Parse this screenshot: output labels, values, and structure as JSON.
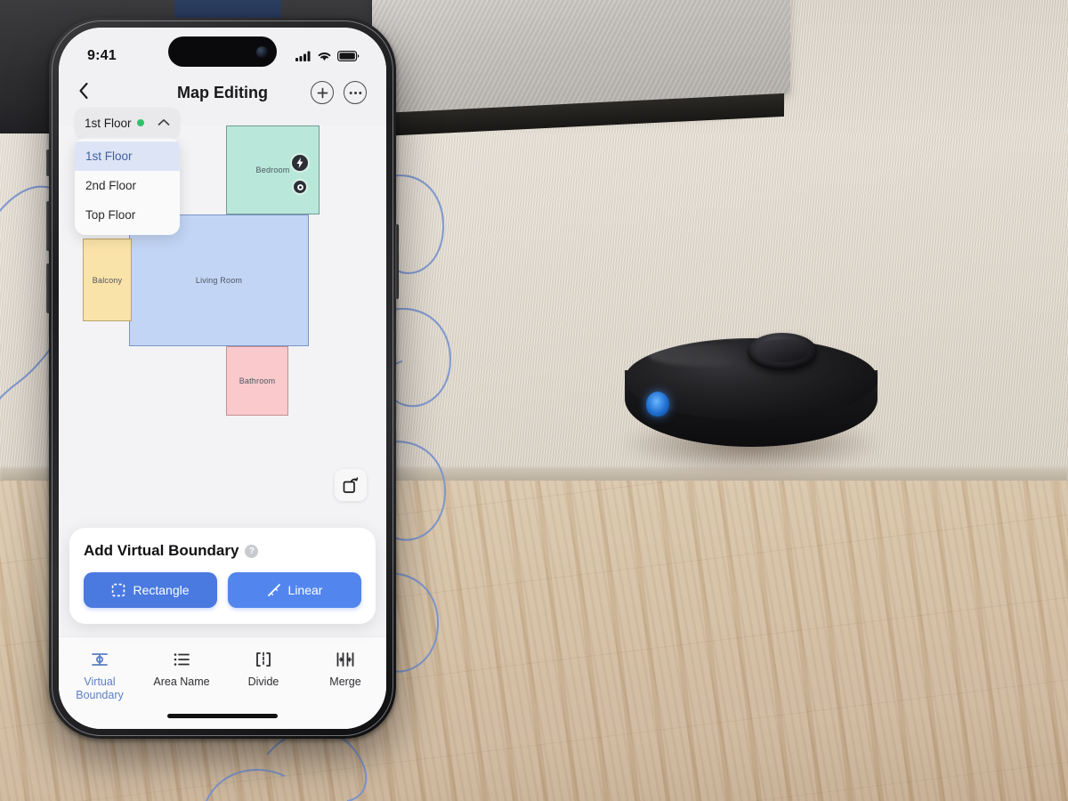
{
  "scene": {
    "description": "Robot vacuum on light wood floor next to beige area rug and grey sofa, with blue robot cleaning path lines overlaid",
    "robot_name": "robot-vacuum",
    "path_color": "#6f8fd0"
  },
  "phone": {
    "statusbar": {
      "time": "9:41",
      "signal_icon": "cellular-signal-icon",
      "wifi_icon": "wifi-icon",
      "battery_icon": "battery-icon"
    },
    "navbar": {
      "back_icon": "chevron-left-icon",
      "title": "Map Editing",
      "add_label": "+",
      "more_label": "···"
    },
    "floor_selector": {
      "current": "1st Floor",
      "status_color": "#2ec26b",
      "chevron": "chevron-up-icon",
      "expanded": true,
      "options": [
        {
          "label": "1st Floor",
          "selected": true
        },
        {
          "label": "2nd Floor",
          "selected": false
        },
        {
          "label": "Top Floor",
          "selected": false
        }
      ]
    },
    "map": {
      "rooms": [
        {
          "name": "Bedroom",
          "color": "#b9e8da",
          "border": "#6f9c94"
        },
        {
          "name": "Living Room",
          "color": "#c2d5f5",
          "border": "#7d93c4"
        },
        {
          "name": "Balcony",
          "color": "#fae3a8",
          "border": "#b9a36a"
        },
        {
          "name": "Bathroom",
          "color": "#fac9cb",
          "border": "#c48f93"
        }
      ],
      "badges": [
        {
          "icon": "charging-bolt-icon",
          "glyph": "⚡"
        },
        {
          "icon": "robot-dock-icon",
          "glyph": "●"
        }
      ],
      "rotate_button_icon": "rotate-reset-icon"
    },
    "virtual_boundary_card": {
      "title": "Add Virtual Boundary",
      "help_icon": "help-question-icon",
      "help_glyph": "?",
      "buttons": [
        {
          "label": "Rectangle",
          "icon": "dashed-rectangle-icon",
          "color": "#4a79e0"
        },
        {
          "label": "Linear",
          "icon": "diagonal-line-icon",
          "color": "#5286ee"
        }
      ]
    },
    "tabbar": {
      "active_color": "#5b7fc4",
      "tabs": [
        {
          "label": "Virtual Boundary",
          "icon": "virtual-boundary-icon",
          "active": true
        },
        {
          "label": "Area Name",
          "icon": "list-lines-icon",
          "active": false
        },
        {
          "label": "Divide",
          "icon": "divide-brackets-icon",
          "active": false
        },
        {
          "label": "Merge",
          "icon": "merge-arrows-icon",
          "active": false
        }
      ]
    }
  }
}
